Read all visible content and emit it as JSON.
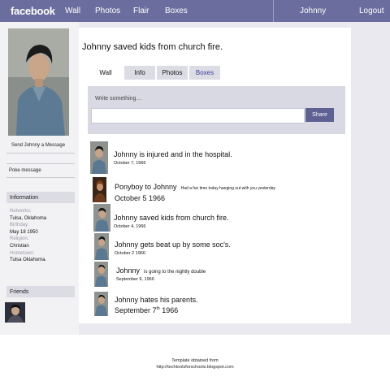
{
  "header": {
    "logo": "facebook",
    "nav": [
      "Wall",
      "Photos",
      "Flair",
      "Boxes"
    ],
    "user": "Johnny",
    "logout": "Logout"
  },
  "sidebar": {
    "send_message": "Send Johnny a Message",
    "poke": "Poke message",
    "information_title": "Information",
    "info": [
      {
        "label": "Networks:",
        "value": "Tulsa, Oklahoma"
      },
      {
        "label": "Birthday:",
        "value": "May 18 1950"
      },
      {
        "label": "Religion:",
        "value": "Christian"
      },
      {
        "label": "Hometown:",
        "value": "Tulsa Oklahoma."
      }
    ],
    "friends_title": "Friends"
  },
  "profile": {
    "status": "Johnny saved kids from church fire."
  },
  "tabs": [
    "Wall",
    "Info",
    "Photos",
    "Boxes"
  ],
  "composer": {
    "placeholder": "Write something…",
    "share": "Share"
  },
  "posts": [
    {
      "main": "Johnny is injured and in the hospital.",
      "date": "October 7, 1966"
    },
    {
      "main": "Ponyboy to Johnny",
      "small": "Had a fun time today hanging  out with you yesterday",
      "date": "October 5 1966"
    },
    {
      "main": "Johnny saved kids from church fire.",
      "date": "October 4, 1966"
    },
    {
      "main": "Johnny gets beat up by some soc's.",
      "date": "October 2 1966"
    },
    {
      "main": "Johnny",
      "small": "is going to the nightly double",
      "date": "September 9, 1966"
    },
    {
      "main": "Johnny hates his parents.",
      "date_prefix": "September 7",
      "date_sup": "th",
      "date_suffix": " 1966"
    }
  ],
  "footer": {
    "line1": "Template obtained from",
    "line2": "http://techtoolsforschools.blogspot.com"
  },
  "colors": {
    "topbar": "#6b6d9e",
    "share_button": "#5f6193",
    "panel": "#d9d9e3"
  }
}
